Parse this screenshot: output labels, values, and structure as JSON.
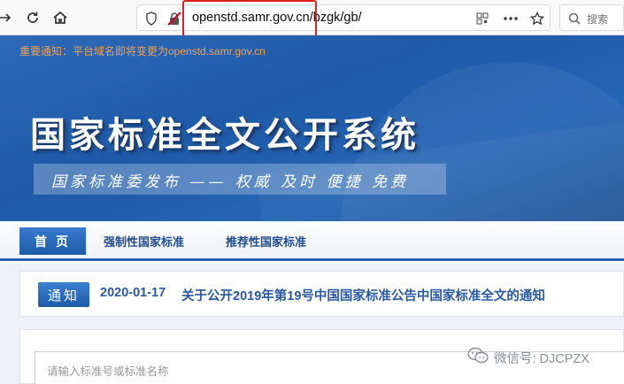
{
  "browser": {
    "url": "openstd.samr.gov.cn/bzgk/gb/",
    "search_placeholder": "搜索"
  },
  "site": {
    "top_notice": "重要通知：平台域名即将变更为openstd.samr.gov.cn",
    "title": "国家标准全文公开系统",
    "slogan": "国家标准委发布 —— 权威 及时 便捷 免费"
  },
  "nav": {
    "home": "首 页",
    "mandatory": "强制性国家标准",
    "recommended": "推荐性国家标准"
  },
  "notice": {
    "tag": "通知",
    "date": "2020-01-17",
    "text": "关于公开2019年第19号中国国家标准公告中国家标准全文的通知"
  },
  "search": {
    "placeholder": "请输入标准号或标准名称"
  },
  "watermark": {
    "text": "微信号: DJCPZX"
  },
  "colors": {
    "banner": "#1e5aa8",
    "nav_accent": "#2a5ea8",
    "notice_text": "#2a5aa0",
    "top_notice": "#f0a050",
    "highlight": "#e02020"
  }
}
